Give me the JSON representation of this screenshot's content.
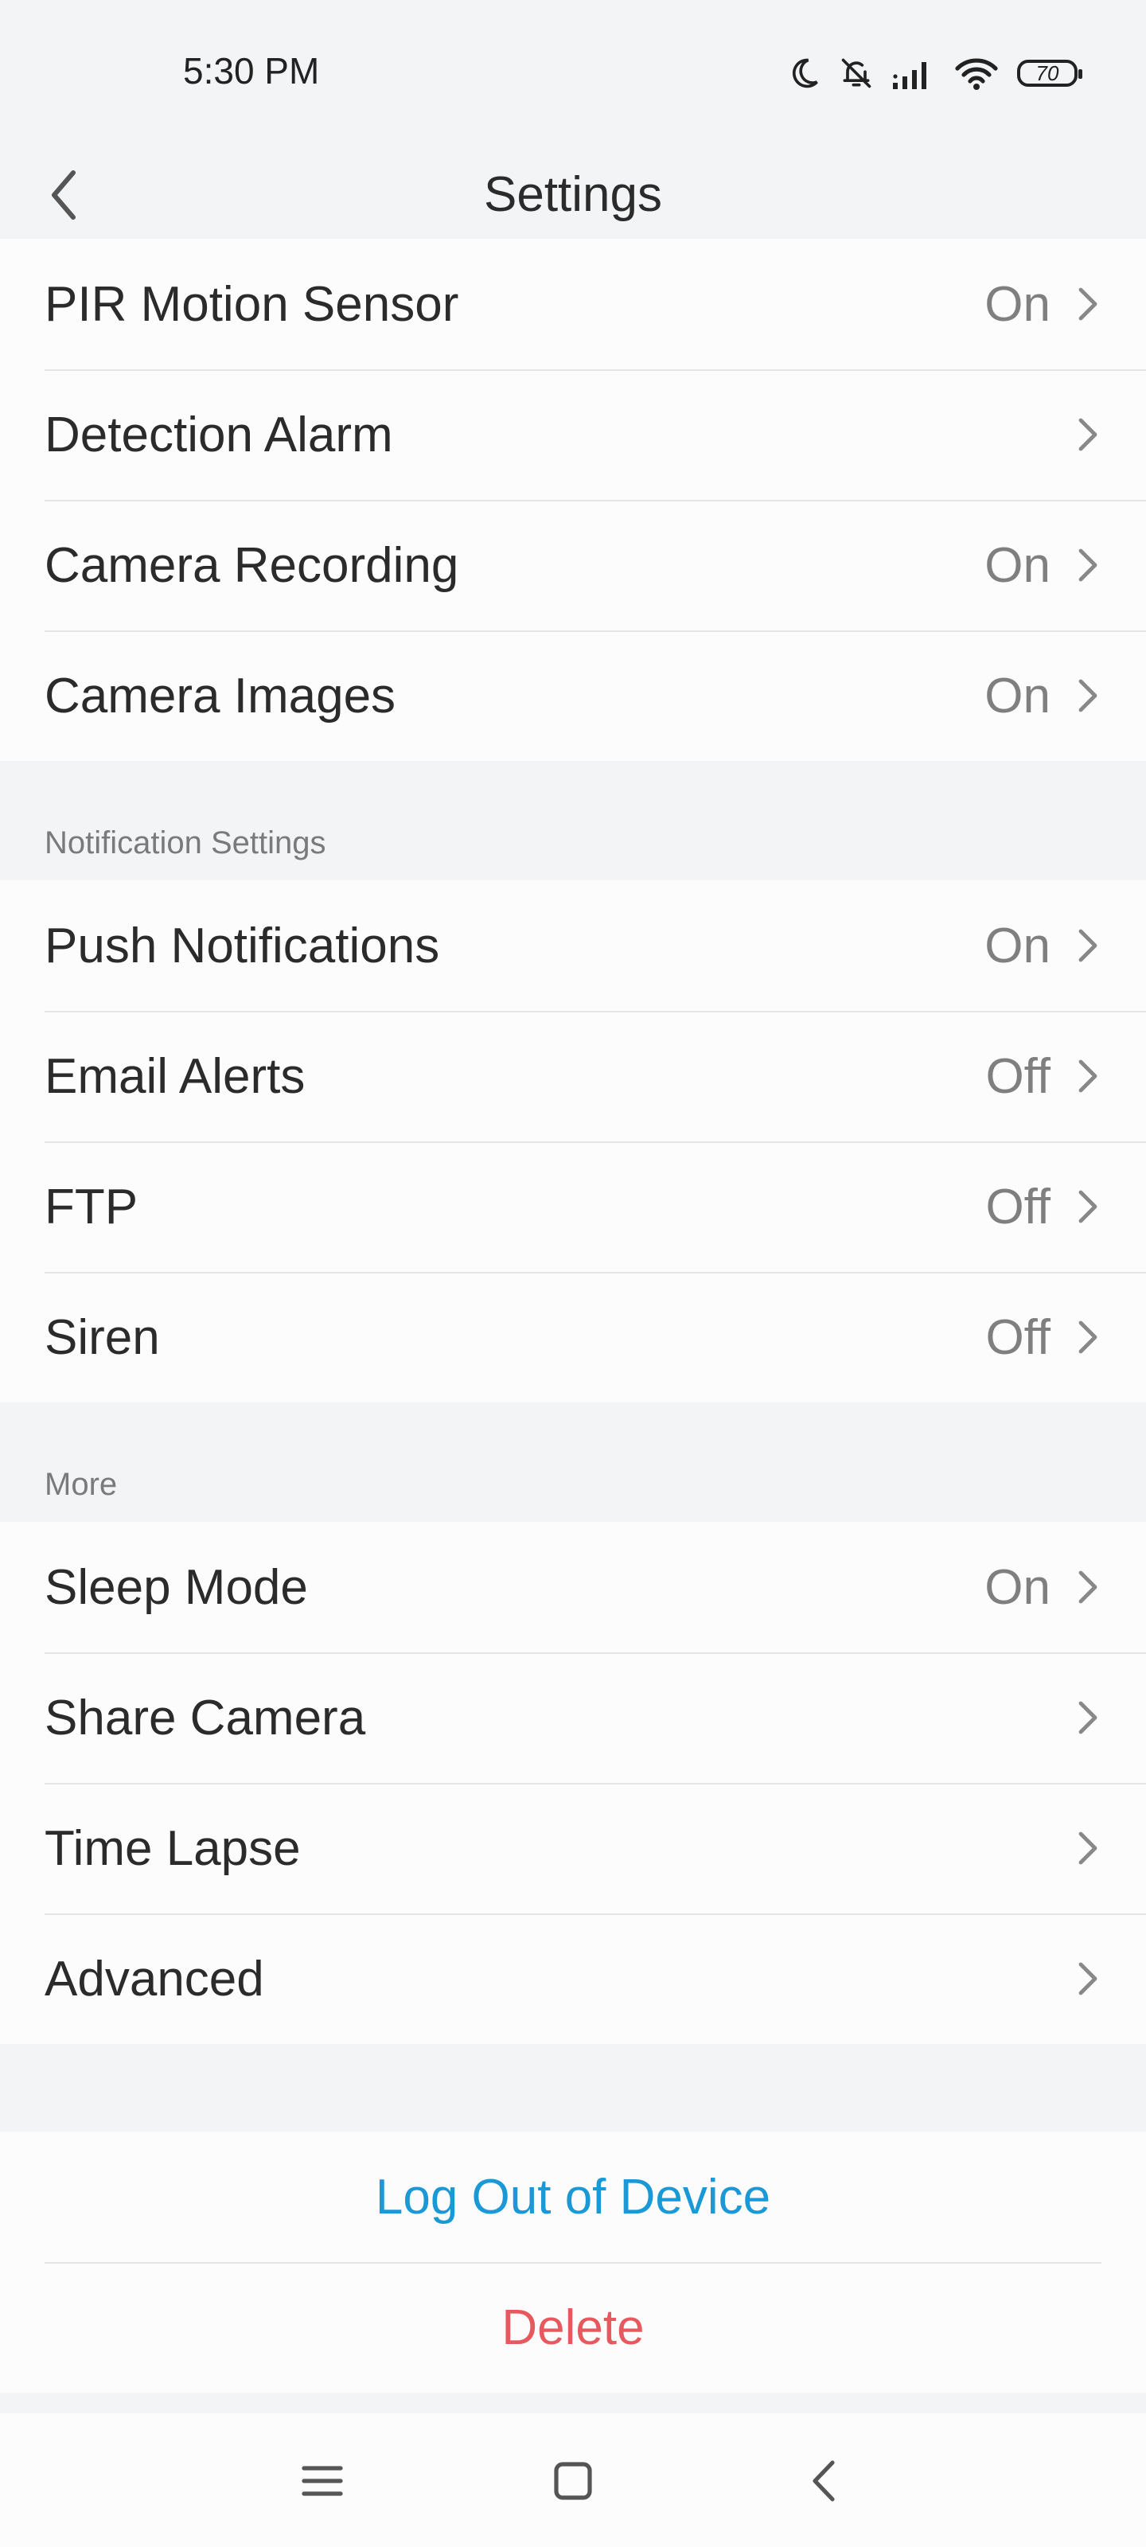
{
  "status_bar": {
    "time": "5:30 PM",
    "battery": "70",
    "icons": [
      "moon-icon",
      "bell-off-icon",
      "signal-icon",
      "wifi-icon",
      "battery-icon"
    ]
  },
  "header": {
    "title": "Settings",
    "back_icon": "chevron-left-icon"
  },
  "group1": {
    "items": [
      {
        "label": "PIR Motion Sensor",
        "value": "On"
      },
      {
        "label": "Detection Alarm",
        "value": ""
      },
      {
        "label": "Camera Recording",
        "value": "On"
      },
      {
        "label": "Camera Images",
        "value": "On"
      }
    ]
  },
  "notification_section": {
    "title": "Notification Settings",
    "items": [
      {
        "label": "Push Notifications",
        "value": "On"
      },
      {
        "label": "Email Alerts",
        "value": "Off"
      },
      {
        "label": "FTP",
        "value": "Off"
      },
      {
        "label": "Siren",
        "value": "Off"
      }
    ]
  },
  "more_section": {
    "title": "More",
    "items": [
      {
        "label": "Sleep Mode",
        "value": "On"
      },
      {
        "label": "Share Camera",
        "value": ""
      },
      {
        "label": "Time Lapse",
        "value": ""
      },
      {
        "label": "Advanced",
        "value": ""
      }
    ]
  },
  "actions": {
    "logout_label": "Log Out of Device",
    "delete_label": "Delete"
  },
  "colors": {
    "background": "#f3f4f6",
    "card": "#fcfcfc",
    "logout": "#1b98d6",
    "delete": "#e65a5f"
  },
  "nav_bar": {
    "icons": [
      "menu-icon",
      "home-icon",
      "back-icon"
    ]
  }
}
